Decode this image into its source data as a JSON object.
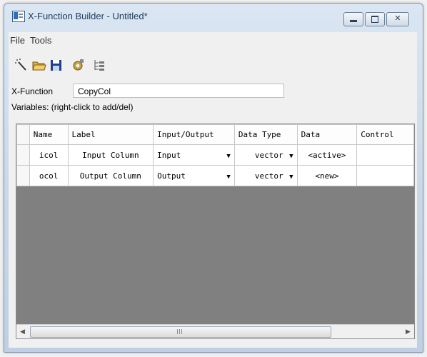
{
  "window": {
    "title": "X-Function Builder - Untitled*"
  },
  "menu": {
    "file": "File",
    "tools": "Tools"
  },
  "toolbar": {
    "icons": [
      "wand-icon",
      "open-folder-icon",
      "save-icon",
      "settings-icon",
      "tree-view-icon"
    ]
  },
  "form": {
    "xfunction_label": "X-Function",
    "xfunction_value": "CopyCol",
    "variables_label": "Variables: (right-click to add/del)"
  },
  "grid": {
    "headers": [
      "Name",
      "Label",
      "Input/Output",
      "Data Type",
      "Data",
      "Control"
    ],
    "rows": [
      {
        "name": "icol",
        "label": "Input Column",
        "io": "Input",
        "type": "vector",
        "data": "<active>",
        "control": ""
      },
      {
        "name": "ocol",
        "label": "Output Column",
        "io": "Output",
        "type": "vector",
        "data": "<new>",
        "control": ""
      }
    ]
  }
}
